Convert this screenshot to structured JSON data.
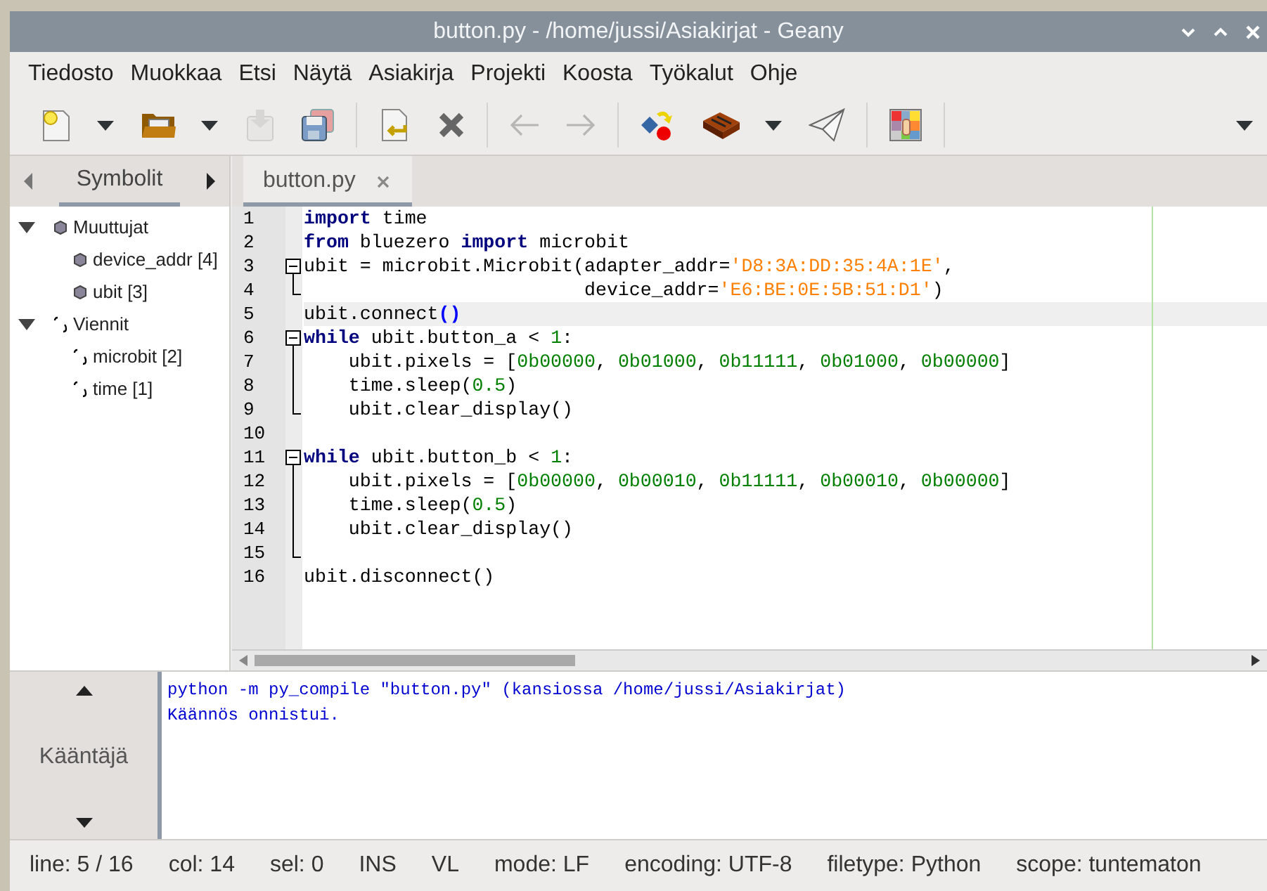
{
  "window": {
    "title": "button.py - /home/jussi/Asiakirjat - Geany"
  },
  "menu": [
    "Tiedosto",
    "Muokkaa",
    "Etsi",
    "Näytä",
    "Asiakirja",
    "Projekti",
    "Koosta",
    "Työkalut",
    "Ohje"
  ],
  "toolbar": [
    {
      "kind": "new",
      "disabled": false
    },
    {
      "kind": "dropdown",
      "disabled": false
    },
    {
      "kind": "open",
      "disabled": false
    },
    {
      "kind": "dropdown",
      "disabled": false
    },
    {
      "kind": "save",
      "disabled": true
    },
    {
      "kind": "save_all",
      "disabled": false
    },
    {
      "kind": "separator",
      "disabled": false
    },
    {
      "kind": "reload",
      "disabled": false
    },
    {
      "kind": "close",
      "disabled": false
    },
    {
      "kind": "separator",
      "disabled": false
    },
    {
      "kind": "back",
      "disabled": true
    },
    {
      "kind": "forward",
      "disabled": true
    },
    {
      "kind": "separator",
      "disabled": false
    },
    {
      "kind": "compile",
      "disabled": false
    },
    {
      "kind": "build",
      "disabled": false
    },
    {
      "kind": "dropdown",
      "disabled": false
    },
    {
      "kind": "run",
      "disabled": false
    },
    {
      "kind": "separator",
      "disabled": false
    },
    {
      "kind": "color",
      "disabled": false
    },
    {
      "kind": "separator",
      "disabled": false
    }
  ],
  "sidebar": {
    "tab": "Symbolit",
    "tree": [
      {
        "label": "Muuttujat",
        "kind": "variable",
        "expanded": true,
        "children": [
          {
            "label": "device_addr [4]",
            "kind": "variable"
          },
          {
            "label": "ubit [3]",
            "kind": "variable"
          }
        ]
      },
      {
        "label": "Viennit",
        "kind": "module",
        "expanded": true,
        "children": [
          {
            "label": "microbit [2]",
            "kind": "module"
          },
          {
            "label": "time [1]",
            "kind": "module"
          }
        ]
      }
    ]
  },
  "editor": {
    "tabs": [
      {
        "label": "button.py",
        "selected": true
      }
    ],
    "lines": [
      {
        "number": "1",
        "current": false,
        "tokens": [
          {
            "text": "import",
            "kind": "keyword"
          },
          {
            "text": " time",
            "kind": "plain"
          }
        ]
      },
      {
        "number": "2",
        "current": false,
        "tokens": [
          {
            "text": "from",
            "kind": "keyword"
          },
          {
            "text": " bluezero ",
            "kind": "plain"
          },
          {
            "text": "import",
            "kind": "keyword"
          },
          {
            "text": " microbit",
            "kind": "plain"
          }
        ]
      },
      {
        "number": "3",
        "fold": {
          "kind": "start"
        },
        "current": false,
        "tokens": [
          {
            "text": "ubit = microbit.Microbit(adapter_addr=",
            "kind": "plain"
          },
          {
            "text": "'D8:3A:DD:35:4A:1E'",
            "kind": "string"
          },
          {
            "text": ",",
            "kind": "plain"
          }
        ]
      },
      {
        "number": "4",
        "fold": {
          "kind": "end"
        },
        "current": false,
        "tokens": [
          {
            "text": "                         device_addr=",
            "kind": "plain"
          },
          {
            "text": "'E6:BE:0E:5B:51:D1'",
            "kind": "string"
          },
          {
            "text": ")",
            "kind": "plain"
          }
        ]
      },
      {
        "number": "5",
        "current": true,
        "tokens": [
          {
            "text": "ubit.connect",
            "kind": "plain"
          },
          {
            "text": "()",
            "kind": "brace_match"
          }
        ]
      },
      {
        "number": "6",
        "fold": {
          "kind": "start"
        },
        "current": false,
        "tokens": [
          {
            "text": "while",
            "kind": "keyword"
          },
          {
            "text": " ubit.button_a < ",
            "kind": "plain"
          },
          {
            "text": "1",
            "kind": "number"
          },
          {
            "text": ":",
            "kind": "plain"
          }
        ]
      },
      {
        "number": "7",
        "fold": {
          "kind": "line"
        },
        "current": false,
        "tokens": [
          {
            "text": "    ubit.pixels = [",
            "kind": "plain"
          },
          {
            "text": "0b00000",
            "kind": "number"
          },
          {
            "text": ", ",
            "kind": "plain"
          },
          {
            "text": "0b01000",
            "kind": "number"
          },
          {
            "text": ", ",
            "kind": "plain"
          },
          {
            "text": "0b11111",
            "kind": "number"
          },
          {
            "text": ", ",
            "kind": "plain"
          },
          {
            "text": "0b01000",
            "kind": "number"
          },
          {
            "text": ", ",
            "kind": "plain"
          },
          {
            "text": "0b00000",
            "kind": "number"
          },
          {
            "text": "]",
            "kind": "plain"
          }
        ]
      },
      {
        "number": "8",
        "fold": {
          "kind": "line"
        },
        "current": false,
        "tokens": [
          {
            "text": "    time.sleep(",
            "kind": "plain"
          },
          {
            "text": "0.5",
            "kind": "number"
          },
          {
            "text": ")",
            "kind": "plain"
          }
        ]
      },
      {
        "number": "9",
        "fold": {
          "kind": "end"
        },
        "current": false,
        "tokens": [
          {
            "text": "    ubit.clear_display()",
            "kind": "plain"
          }
        ]
      },
      {
        "number": "10",
        "current": false
      },
      {
        "number": "11",
        "fold": {
          "kind": "start"
        },
        "current": false,
        "tokens": [
          {
            "text": "while",
            "kind": "keyword"
          },
          {
            "text": " ubit.button_b < ",
            "kind": "plain"
          },
          {
            "text": "1",
            "kind": "number"
          },
          {
            "text": ":",
            "kind": "plain"
          }
        ]
      },
      {
        "number": "12",
        "fold": {
          "kind": "line"
        },
        "current": false,
        "tokens": [
          {
            "text": "    ubit.pixels = [",
            "kind": "plain"
          },
          {
            "text": "0b00000",
            "kind": "number"
          },
          {
            "text": ", ",
            "kind": "plain"
          },
          {
            "text": "0b00010",
            "kind": "number"
          },
          {
            "text": ", ",
            "kind": "plain"
          },
          {
            "text": "0b11111",
            "kind": "number"
          },
          {
            "text": ", ",
            "kind": "plain"
          },
          {
            "text": "0b00010",
            "kind": "number"
          },
          {
            "text": ", ",
            "kind": "plain"
          },
          {
            "text": "0b00000",
            "kind": "number"
          },
          {
            "text": "]",
            "kind": "plain"
          }
        ]
      },
      {
        "number": "13",
        "fold": {
          "kind": "line"
        },
        "current": false,
        "tokens": [
          {
            "text": "    time.sleep(",
            "kind": "plain"
          },
          {
            "text": "0.5",
            "kind": "number"
          },
          {
            "text": ")",
            "kind": "plain"
          }
        ]
      },
      {
        "number": "14",
        "fold": {
          "kind": "line"
        },
        "current": false,
        "tokens": [
          {
            "text": "    ubit.clear_display()",
            "kind": "plain"
          }
        ]
      },
      {
        "number": "15",
        "fold": {
          "kind": "end"
        },
        "current": false
      },
      {
        "number": "16",
        "current": false,
        "tokens": [
          {
            "text": "ubit.disconnect()",
            "kind": "plain"
          }
        ]
      }
    ]
  },
  "messages": {
    "tab": "Kääntäjä",
    "lines": [
      "python -m py_compile \"button.py\" (kansiossa /home/jussi/Asiakirjat)",
      "Käännös onnistui."
    ]
  },
  "status_bar": [
    "line: 5 / 16",
    "col: 14",
    "sel: 0",
    "INS",
    "VL",
    "mode: LF",
    "encoding: UTF-8",
    "filetype: Python",
    "scope: tuntematon"
  ]
}
